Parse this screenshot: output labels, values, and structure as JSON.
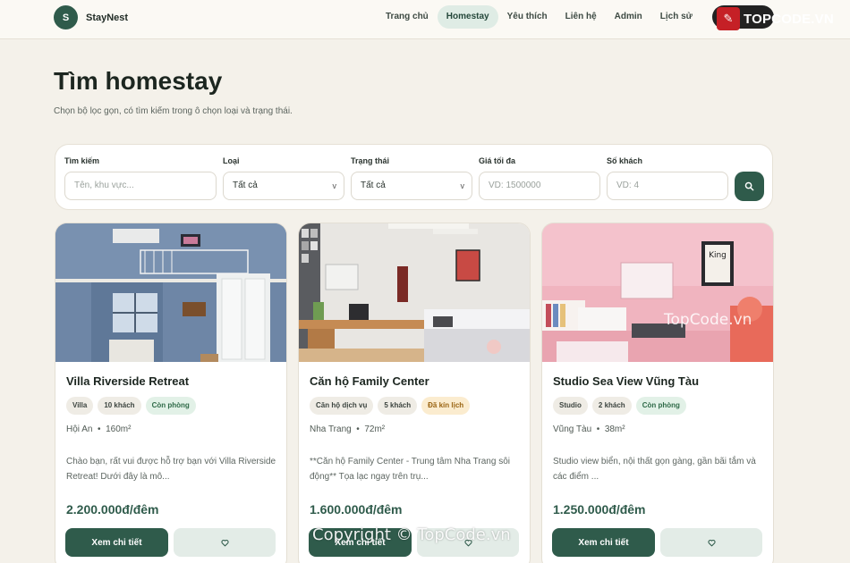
{
  "brand": {
    "logo_letter": "S",
    "name": "StayNest"
  },
  "nav": {
    "items": [
      {
        "label": "Trang chủ",
        "active": false
      },
      {
        "label": "Homestay",
        "active": true
      },
      {
        "label": "Yêu thích",
        "active": false
      },
      {
        "label": "Liên hệ",
        "active": false
      },
      {
        "label": "Admin",
        "active": false
      },
      {
        "label": "Lịch sử",
        "active": false
      }
    ]
  },
  "watermark": {
    "logo_text": "TOPCODE.VN",
    "center_text": "TopCode.vn",
    "bottom_text": "Copyright © TopCode.vn"
  },
  "page": {
    "title": "Tìm homestay",
    "subtitle": "Chọn bộ lọc gọn, có tìm kiếm trong ô chọn loại và trạng thái."
  },
  "filters": {
    "search": {
      "label": "Tìm kiếm",
      "placeholder": "Tên, khu vực..."
    },
    "type": {
      "label": "Loại",
      "value": "Tất cả"
    },
    "status": {
      "label": "Trạng thái",
      "value": "Tất cả"
    },
    "max_price": {
      "label": "Giá tối đa",
      "placeholder": "VD: 1500000"
    },
    "guests": {
      "label": "Số khách",
      "placeholder": "VD: 4"
    }
  },
  "cards": [
    {
      "title": "Villa Riverside Retreat",
      "tags": [
        {
          "label": "Villa",
          "kind": "neutral"
        },
        {
          "label": "10 khách",
          "kind": "neutral"
        },
        {
          "label": "Còn phòng",
          "kind": "ok"
        }
      ],
      "location": "Hội An",
      "area": "160m²",
      "desc": "Chào bạn, rất vui được hỗ trợ bạn với Villa Riverside Retreat! Dưới đây là mô...",
      "price": "2.200.000đ/đêm",
      "detail_label": "Xem chi tiết"
    },
    {
      "title": "Căn hộ Family Center",
      "tags": [
        {
          "label": "Căn hộ dịch vụ",
          "kind": "neutral"
        },
        {
          "label": "5 khách",
          "kind": "neutral"
        },
        {
          "label": "Đã kín lịch",
          "kind": "warn"
        }
      ],
      "location": "Nha Trang",
      "area": "72m²",
      "desc": "**Căn hộ Family Center - Trung tâm Nha Trang sôi động** Tọa lạc ngay trên trụ...",
      "price": "1.600.000đ/đêm",
      "detail_label": "Xem chi tiết"
    },
    {
      "title": "Studio Sea View Vũng Tàu",
      "tags": [
        {
          "label": "Studio",
          "kind": "neutral"
        },
        {
          "label": "2 khách",
          "kind": "neutral"
        },
        {
          "label": "Còn phòng",
          "kind": "ok"
        }
      ],
      "location": "Vũng Tàu",
      "area": "38m²",
      "desc": "Studio view biển, nội thất gọn gàng, gần bãi tắm và các điểm ...",
      "price": "1.250.000đ/đêm",
      "detail_label": "Xem chi tiết",
      "photo_sign": "King"
    }
  ],
  "colors": {
    "accent": "#2f5b4b",
    "background": "#f4f1ea",
    "ok": "#2f6a48",
    "warn": "#9a6412"
  }
}
